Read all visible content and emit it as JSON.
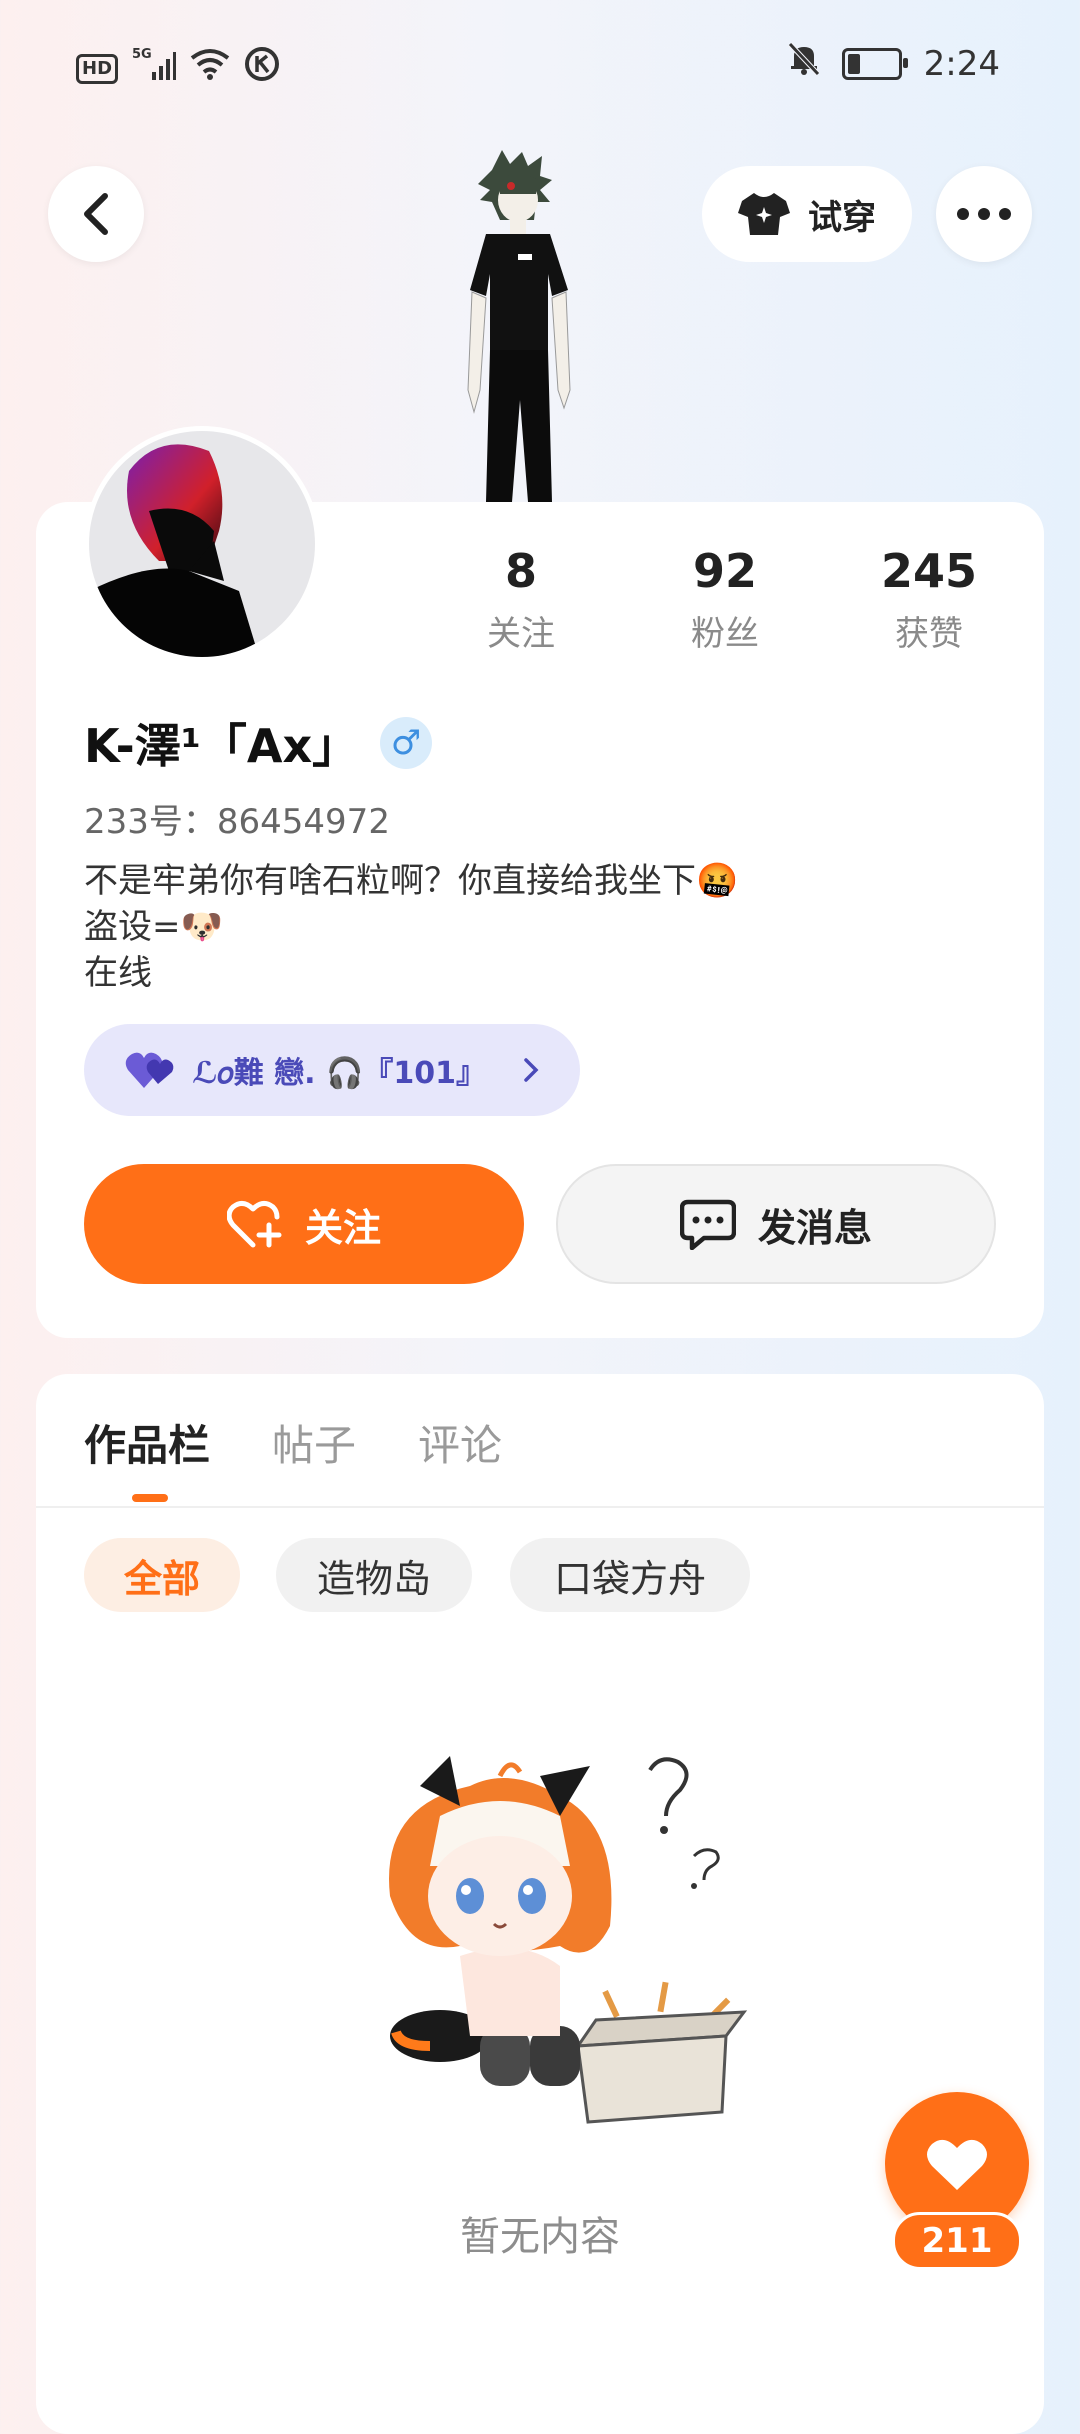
{
  "status": {
    "time": "2:24",
    "hd": "HD",
    "network": "5G"
  },
  "topbar": {
    "tryon_label": "试穿"
  },
  "profile": {
    "stats": [
      {
        "value": "8",
        "label": "关注"
      },
      {
        "value": "92",
        "label": "粉丝"
      },
      {
        "value": "245",
        "label": "获赞"
      }
    ],
    "name": "K-澤¹「Ax」",
    "gender_symbol": "♂",
    "id_line": "233号：86454972",
    "bio_lines": [
      "不是牢弟你有啥石粒啊？你直接给我坐下🤬",
      "盗设=🐶",
      "在线"
    ],
    "relation_tag": "ℒ𝑜難 戀. 🎧『101』"
  },
  "actions": {
    "follow_label": "关注",
    "message_label": "发消息"
  },
  "tabs": [
    {
      "label": "作品栏",
      "active": true
    },
    {
      "label": "帖子",
      "active": false
    },
    {
      "label": "评论",
      "active": false
    }
  ],
  "chips": [
    {
      "label": "全部",
      "active": true
    },
    {
      "label": "造物岛",
      "active": false
    },
    {
      "label": "口袋方舟",
      "active": false
    }
  ],
  "empty_state": {
    "text": "暂无内容"
  },
  "fab": {
    "count": "211"
  },
  "colors": {
    "accent": "#ff6f17",
    "relation_tag_bg": "#e7e7fb"
  }
}
